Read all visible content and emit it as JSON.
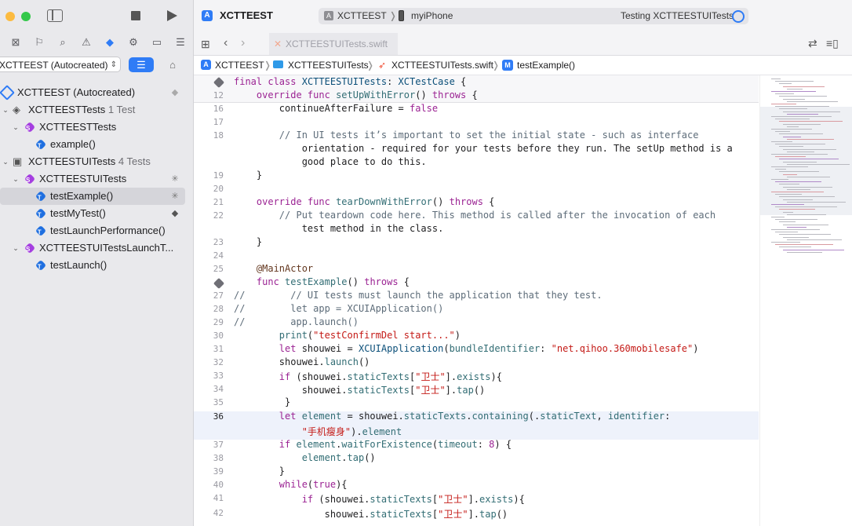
{
  "sidebar": {
    "scheme_filter": "XCTTEEST (Autocreated)",
    "rows": [
      {
        "label": "XCTTEEST (Autocreated)",
        "count": "",
        "icon": "test-plan-icon"
      },
      {
        "label": "XCTTEESTTests",
        "count": "1 Test",
        "icon": "test-bundle-icon"
      },
      {
        "label": "XCTTEESTTests",
        "count": "",
        "icon": "test-class-icon"
      },
      {
        "label": "example()",
        "count": "",
        "icon": "test-method-icon"
      },
      {
        "label": "XCTTEESTUITests",
        "count": "4 Tests",
        "icon": "ui-test-bundle-icon"
      },
      {
        "label": "XCTTEESTUITests",
        "count": "",
        "icon": "test-class-icon"
      },
      {
        "label": "testExample()",
        "count": "",
        "icon": "test-method-icon"
      },
      {
        "label": "testMyTest()",
        "count": "",
        "icon": "test-method-icon"
      },
      {
        "label": "testLaunchPerformance()",
        "count": "",
        "icon": "test-method-icon"
      },
      {
        "label": "XCTTEESTUITestsLaunchT...",
        "count": "",
        "icon": "test-class-icon"
      },
      {
        "label": "testLaunch()",
        "count": "",
        "icon": "test-method-icon"
      }
    ]
  },
  "toolbar": {
    "project": "XCTTEEST",
    "scheme": "XCTTEEST",
    "device": "myiPhone",
    "status": "Testing XCTTEESTUITests"
  },
  "tab": {
    "file": "XCTTEESTUITests.swift"
  },
  "jumpbar": {
    "project": "XCTTEEST",
    "group": "XCTTEESTUITests",
    "file": "XCTTEESTUITests.swift",
    "method": "testExample()"
  },
  "editor": {
    "sticky1": "final class XCTTEESTUITests: XCTestCase {",
    "sticky2_num": "12",
    "sticky2": "    override func setUpWithError() throws {",
    "lines": [
      {
        "n": "16",
        "t": "        continueAfterFailure = false"
      },
      {
        "n": "17",
        "t": ""
      },
      {
        "n": "18",
        "t": "        // In UI tests it’s important to set the initial state - such as interface"
      },
      {
        "n": "",
        "t": "            orientation - required for your tests before they run. The setUp method is a"
      },
      {
        "n": "",
        "t": "            good place to do this."
      },
      {
        "n": "19",
        "t": "    }"
      },
      {
        "n": "20",
        "t": ""
      },
      {
        "n": "21",
        "t": "    override func tearDownWithError() throws {"
      },
      {
        "n": "22",
        "t": "        // Put teardown code here. This method is called after the invocation of each"
      },
      {
        "n": "",
        "t": "            test method in the class."
      },
      {
        "n": "23",
        "t": "    }"
      },
      {
        "n": "24",
        "t": ""
      },
      {
        "n": "25",
        "t": "    @MainActor"
      },
      {
        "n": "",
        "t": "    func testExample() throws {"
      },
      {
        "n": "27",
        "t": "//        // UI tests must launch the application that they test."
      },
      {
        "n": "28",
        "t": "//        let app = XCUIApplication()"
      },
      {
        "n": "29",
        "t": "//        app.launch()"
      },
      {
        "n": "30",
        "t": "        print(\"testConfirmDel start...\")"
      },
      {
        "n": "31",
        "t": "        let shouwei = XCUIApplication(bundleIdentifier: \"net.qihoo.360mobilesafe\")"
      },
      {
        "n": "32",
        "t": "        shouwei.launch()"
      },
      {
        "n": "33",
        "t": "        if (shouwei.staticTexts[\"卫士\"].exists){"
      },
      {
        "n": "34",
        "t": "            shouwei.staticTexts[\"卫士\"].tap()"
      },
      {
        "n": "35",
        "t": "         }"
      },
      {
        "n": "36",
        "t": "        let element = shouwei.staticTexts.containing(.staticText, identifier:"
      },
      {
        "n": "",
        "t": "            \"手机瘦身\").element"
      },
      {
        "n": "37",
        "t": "        if element.waitForExistence(timeout: 8) {"
      },
      {
        "n": "38",
        "t": "            element.tap()"
      },
      {
        "n": "39",
        "t": "        }"
      },
      {
        "n": "40",
        "t": "        while(true){"
      },
      {
        "n": "41",
        "t": "            if (shouwei.staticTexts[\"卫士\"].exists){"
      },
      {
        "n": "42",
        "t": "                shouwei.staticTexts[\"卫士\"].tap()"
      }
    ]
  }
}
